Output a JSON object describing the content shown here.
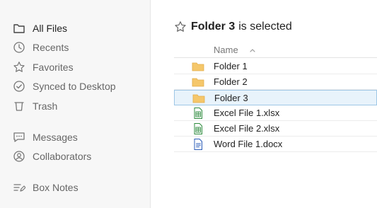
{
  "sidebar": {
    "items": [
      {
        "label": "All Files",
        "icon": "folder-icon",
        "active": true
      },
      {
        "label": "Recents",
        "icon": "clock-icon"
      },
      {
        "label": "Favorites",
        "icon": "star-icon"
      },
      {
        "label": "Synced to Desktop",
        "icon": "check-circle-icon"
      },
      {
        "label": "Trash",
        "icon": "trash-icon"
      },
      {
        "label": "Messages",
        "icon": "chat-icon"
      },
      {
        "label": "Collaborators",
        "icon": "user-circle-icon"
      },
      {
        "label": "Box Notes",
        "icon": "notes-icon"
      }
    ]
  },
  "header": {
    "selected_name": "Folder 3",
    "suffix": "is selected"
  },
  "table": {
    "column_name": "Name",
    "sort": "ascending",
    "rows": [
      {
        "name": "Folder 1",
        "type": "folder"
      },
      {
        "name": "Folder 2",
        "type": "folder"
      },
      {
        "name": "Folder 3",
        "type": "folder",
        "selected": true
      },
      {
        "name": "Excel File 1.xlsx",
        "type": "excel"
      },
      {
        "name": "Excel File 2.xlsx",
        "type": "excel"
      },
      {
        "name": "Word File 1.docx",
        "type": "word"
      }
    ]
  },
  "colors": {
    "folder": "#f5c76b",
    "excel": "#2e8b3e",
    "word": "#2b5cb8",
    "selected_bg": "#e8f3fb",
    "selected_border": "#9ec7e6"
  }
}
